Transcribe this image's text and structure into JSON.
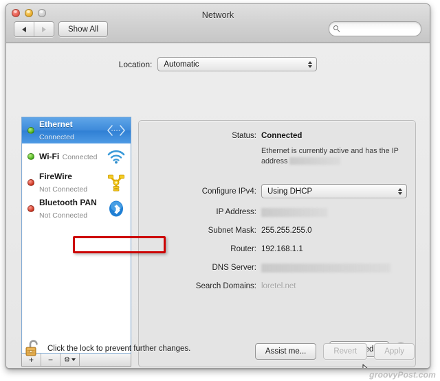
{
  "window": {
    "title": "Network",
    "traffic_lights": [
      "close-button",
      "minimize-button",
      "zoom-button"
    ]
  },
  "toolbar": {
    "back_label": "◀",
    "forward_label": "▶",
    "show_all_label": "Show All",
    "search_placeholder": "",
    "search_value": "",
    "search_icon": "search-icon"
  },
  "location": {
    "label": "Location:",
    "value": "Automatic"
  },
  "sidebar": {
    "services": [
      {
        "name": "Ethernet",
        "status": "Connected",
        "dot": "green",
        "icon": "ethernet-icon",
        "selected": true
      },
      {
        "name": "Wi-Fi",
        "status": "Connected",
        "dot": "green",
        "icon": "wifi-icon",
        "selected": false
      },
      {
        "name": "FireWire",
        "status": "Not Connected",
        "dot": "red",
        "icon": "firewire-icon",
        "selected": false
      },
      {
        "name": "Bluetooth PAN",
        "status": "Not Connected",
        "dot": "red",
        "icon": "bluetooth-icon",
        "selected": false
      }
    ],
    "add_label": "+",
    "remove_label": "−",
    "action_label": "⚙"
  },
  "detail": {
    "status_label": "Status:",
    "status_value": "Connected",
    "status_description_before": "Ethernet is currently active and has the IP",
    "status_description_after": "address",
    "configure_label": "Configure IPv4:",
    "configure_value": "Using DHCP",
    "ip_address_label": "IP Address:",
    "ip_address_value": "",
    "subnet_label": "Subnet Mask:",
    "subnet_value": "255.255.255.0",
    "router_label": "Router:",
    "router_value": "192.168.1.1",
    "dns_label": "DNS Server:",
    "dns_value": "",
    "search_domains_label": "Search Domains:",
    "search_domains_value": "loretel.net",
    "advanced_label": "Advanced...",
    "help_label": "?"
  },
  "footer": {
    "lock_icon": "unlocked-padlock-icon",
    "lock_text": "Click the lock to prevent further changes.",
    "assist_label": "Assist me...",
    "revert_label": "Revert",
    "apply_label": "Apply"
  },
  "annotation": {
    "highlight_target": "router-row",
    "highlight_color": "#cc0000"
  },
  "watermark": {
    "text": "groovyPost.com"
  }
}
